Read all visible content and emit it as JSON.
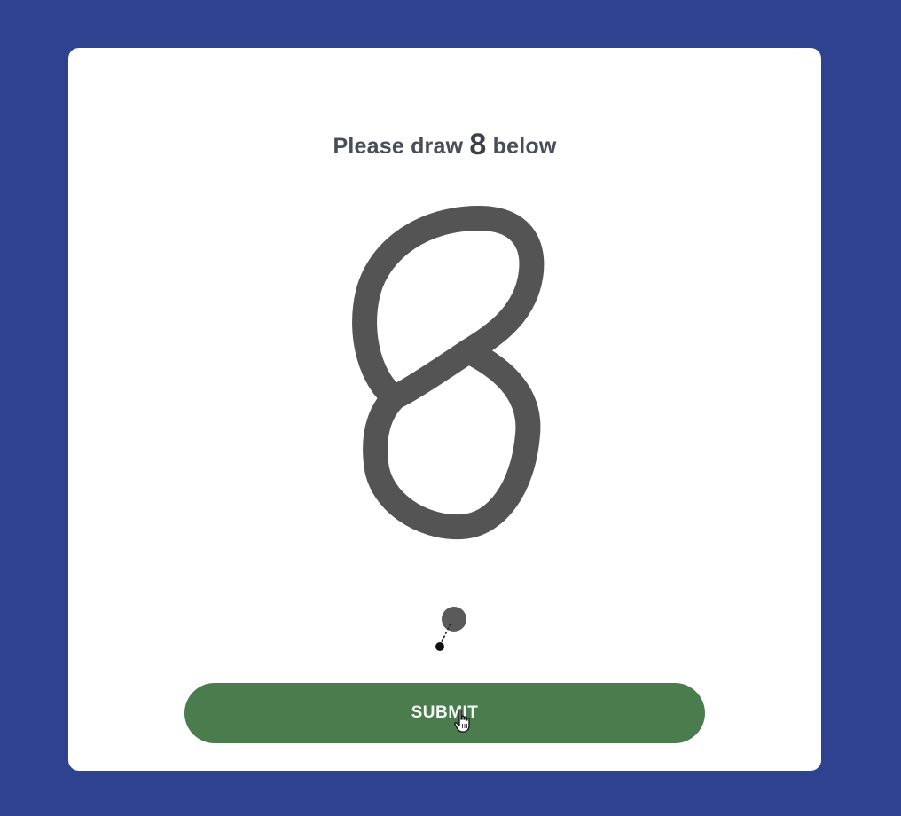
{
  "prompt": {
    "prefix": "Please draw",
    "digit": "8",
    "suffix": "below"
  },
  "submit": {
    "label": "SUBMIT",
    "color": "#4a7c4e"
  },
  "colors": {
    "background": "#2e428f",
    "card": "#ffffff",
    "ink": "#545454"
  },
  "icons": {
    "pen": "pen-tip-icon",
    "cursor": "hand-pointer-icon"
  }
}
